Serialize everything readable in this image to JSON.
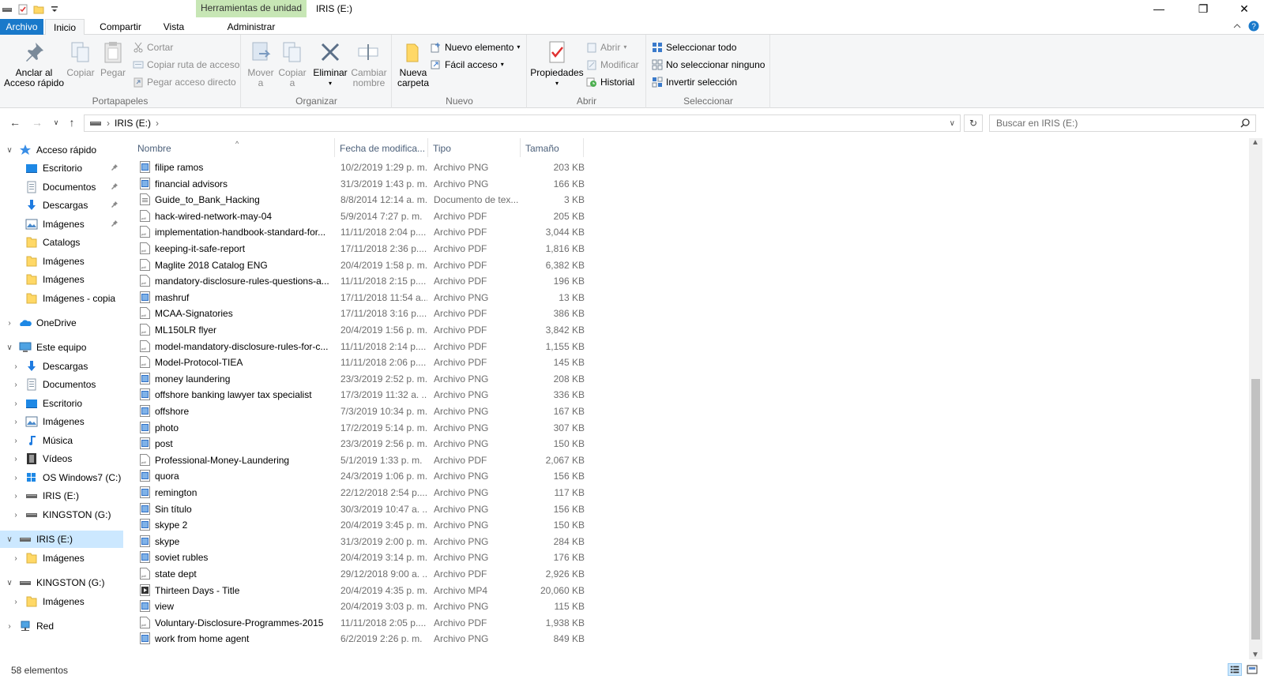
{
  "titlebar": {
    "context_tab": "Herramientas de unidad",
    "title": "IRIS (E:)",
    "minimize": "—",
    "restore": "❐",
    "close": "✕"
  },
  "tabs": {
    "archivo": "Archivo",
    "inicio": "Inicio",
    "compartir": "Compartir",
    "vista": "Vista",
    "administrar": "Administrar"
  },
  "ribbon": {
    "portapapeles": {
      "label": "Portapapeles",
      "pin": "Anclar al\nAcceso rápido",
      "pin_l1": "Anclar al",
      "pin_l2": "Acceso rápido",
      "copy": "Copiar",
      "paste": "Pegar",
      "cut": "Cortar",
      "copy_path": "Copiar ruta de acceso",
      "paste_shortcut": "Pegar acceso directo"
    },
    "organizar": {
      "label": "Organizar",
      "move_l1": "Mover",
      "move_l2": "a",
      "copy_l1": "Copiar",
      "copy_l2": "a",
      "delete": "Eliminar",
      "rename_l1": "Cambiar",
      "rename_l2": "nombre"
    },
    "nuevo": {
      "label": "Nuevo",
      "folder_l1": "Nueva",
      "folder_l2": "carpeta",
      "new_item": "Nuevo elemento",
      "easy_access": "Fácil acceso"
    },
    "abrir": {
      "label": "Abrir",
      "properties": "Propiedades",
      "open": "Abrir",
      "edit": "Modificar",
      "history": "Historial"
    },
    "seleccionar": {
      "label": "Seleccionar",
      "select_all": "Seleccionar todo",
      "select_none": "No seleccionar ninguno",
      "invert": "Invertir selección"
    }
  },
  "address": {
    "path": "IRIS (E:)",
    "search_placeholder": "Buscar en IRIS (E:)"
  },
  "navpane": [
    {
      "label": "Acceso rápido",
      "icon": "star-icon",
      "level": 0,
      "chev": "∨"
    },
    {
      "label": "Escritorio",
      "icon": "desktop-icon",
      "level": 1,
      "pinned": true
    },
    {
      "label": "Documentos",
      "icon": "documents-icon",
      "level": 1,
      "pinned": true
    },
    {
      "label": "Descargas",
      "icon": "downloads-icon",
      "level": 1,
      "pinned": true
    },
    {
      "label": "Imágenes",
      "icon": "pictures-icon",
      "level": 1,
      "pinned": true
    },
    {
      "label": "Catalogs",
      "icon": "folder-icon",
      "level": 1
    },
    {
      "label": "Imágenes",
      "icon": "folder-icon",
      "level": 1
    },
    {
      "label": "Imágenes",
      "icon": "folder-icon",
      "level": 1
    },
    {
      "label": "Imágenes - copia",
      "icon": "folder-icon",
      "level": 1
    },
    {
      "label": "OneDrive",
      "icon": "onedrive-icon",
      "level": 0,
      "chev": "›"
    },
    {
      "label": "Este equipo",
      "icon": "computer-icon",
      "level": 0,
      "chev": "∨"
    },
    {
      "label": "Descargas",
      "icon": "downloads-icon",
      "level": 1,
      "chev": "›"
    },
    {
      "label": "Documentos",
      "icon": "documents-icon",
      "level": 1,
      "chev": "›"
    },
    {
      "label": "Escritorio",
      "icon": "desktop-icon",
      "level": 1,
      "chev": "›"
    },
    {
      "label": "Imágenes",
      "icon": "pictures-icon",
      "level": 1,
      "chev": "›"
    },
    {
      "label": "Música",
      "icon": "music-icon",
      "level": 1,
      "chev": "›"
    },
    {
      "label": "Vídeos",
      "icon": "videos-icon",
      "level": 1,
      "chev": "›"
    },
    {
      "label": "OS Windows7 (C:)",
      "icon": "windows-drive-icon",
      "level": 1,
      "chev": "›"
    },
    {
      "label": "IRIS (E:)",
      "icon": "drive-icon",
      "level": 1,
      "chev": "›"
    },
    {
      "label": "KINGSTON (G:)",
      "icon": "drive-icon",
      "level": 1,
      "chev": "›"
    },
    {
      "label": "IRIS (E:)",
      "icon": "drive-icon",
      "level": 0,
      "chev": "∨",
      "selected": true
    },
    {
      "label": "Imágenes",
      "icon": "folder-icon",
      "level": 1,
      "chev": "›"
    },
    {
      "label": "KINGSTON (G:)",
      "icon": "drive-icon",
      "level": 0,
      "chev": "∨"
    },
    {
      "label": "Imágenes",
      "icon": "folder-icon",
      "level": 1,
      "chev": "›"
    },
    {
      "label": "Red",
      "icon": "network-icon",
      "level": 0,
      "chev": "›"
    }
  ],
  "columns": {
    "name": "Nombre",
    "date": "Fecha de modifica...",
    "type": "Tipo",
    "size": "Tamaño"
  },
  "files": [
    {
      "name": "filipe ramos",
      "date": "10/2/2019 1:29 p. m.",
      "type": "Archivo PNG",
      "size": "203 KB",
      "kind": "png"
    },
    {
      "name": "financial advisors",
      "date": "31/3/2019 1:43 p. m.",
      "type": "Archivo PNG",
      "size": "166 KB",
      "kind": "png"
    },
    {
      "name": "Guide_to_Bank_Hacking",
      "date": "8/8/2014 12:14 a. m.",
      "type": "Documento de tex...",
      "size": "3 KB",
      "kind": "txt"
    },
    {
      "name": "hack-wired-network-may-04",
      "date": "5/9/2014 7:27 p. m.",
      "type": "Archivo PDF",
      "size": "205 KB",
      "kind": "pdf"
    },
    {
      "name": "implementation-handbook-standard-for...",
      "date": "11/11/2018 2:04 p....",
      "type": "Archivo PDF",
      "size": "3,044 KB",
      "kind": "pdf"
    },
    {
      "name": "keeping-it-safe-report",
      "date": "17/11/2018 2:36 p....",
      "type": "Archivo PDF",
      "size": "1,816 KB",
      "kind": "pdf"
    },
    {
      "name": "Maglite 2018 Catalog ENG",
      "date": "20/4/2019 1:58 p. m.",
      "type": "Archivo PDF",
      "size": "6,382 KB",
      "kind": "pdf"
    },
    {
      "name": "mandatory-disclosure-rules-questions-a...",
      "date": "11/11/2018 2:15 p....",
      "type": "Archivo PDF",
      "size": "196 KB",
      "kind": "pdf"
    },
    {
      "name": "mashruf",
      "date": "17/11/2018 11:54 a...",
      "type": "Archivo PNG",
      "size": "13 KB",
      "kind": "png"
    },
    {
      "name": "MCAA-Signatories",
      "date": "17/11/2018 3:16 p....",
      "type": "Archivo PDF",
      "size": "386 KB",
      "kind": "pdf"
    },
    {
      "name": "ML150LR flyer",
      "date": "20/4/2019 1:56 p. m.",
      "type": "Archivo PDF",
      "size": "3,842 KB",
      "kind": "pdf"
    },
    {
      "name": "model-mandatory-disclosure-rules-for-c...",
      "date": "11/11/2018 2:14 p....",
      "type": "Archivo PDF",
      "size": "1,155 KB",
      "kind": "pdf"
    },
    {
      "name": "Model-Protocol-TIEA",
      "date": "11/11/2018 2:06 p....",
      "type": "Archivo PDF",
      "size": "145 KB",
      "kind": "pdf"
    },
    {
      "name": "money laundering",
      "date": "23/3/2019 2:52 p. m.",
      "type": "Archivo PNG",
      "size": "208 KB",
      "kind": "png"
    },
    {
      "name": "offshore banking lawyer tax specialist",
      "date": "17/3/2019 11:32 a. ...",
      "type": "Archivo PNG",
      "size": "336 KB",
      "kind": "png"
    },
    {
      "name": "offshore",
      "date": "7/3/2019 10:34 p. m.",
      "type": "Archivo PNG",
      "size": "167 KB",
      "kind": "png"
    },
    {
      "name": "photo",
      "date": "17/2/2019 5:14 p. m.",
      "type": "Archivo PNG",
      "size": "307 KB",
      "kind": "png"
    },
    {
      "name": "post",
      "date": "23/3/2019 2:56 p. m.",
      "type": "Archivo PNG",
      "size": "150 KB",
      "kind": "png"
    },
    {
      "name": "Professional-Money-Laundering",
      "date": "5/1/2019 1:33 p. m.",
      "type": "Archivo PDF",
      "size": "2,067 KB",
      "kind": "pdf"
    },
    {
      "name": "quora",
      "date": "24/3/2019 1:06 p. m.",
      "type": "Archivo PNG",
      "size": "156 KB",
      "kind": "png"
    },
    {
      "name": "remington",
      "date": "22/12/2018 2:54 p....",
      "type": "Archivo PNG",
      "size": "117 KB",
      "kind": "png"
    },
    {
      "name": "Sin título",
      "date": "30/3/2019 10:47 a. ...",
      "type": "Archivo PNG",
      "size": "156 KB",
      "kind": "png"
    },
    {
      "name": "skype 2",
      "date": "20/4/2019 3:45 p. m.",
      "type": "Archivo PNG",
      "size": "150 KB",
      "kind": "png"
    },
    {
      "name": "skype",
      "date": "31/3/2019 2:00 p. m.",
      "type": "Archivo PNG",
      "size": "284 KB",
      "kind": "png"
    },
    {
      "name": "soviet rubles",
      "date": "20/4/2019 3:14 p. m.",
      "type": "Archivo PNG",
      "size": "176 KB",
      "kind": "png"
    },
    {
      "name": "state dept",
      "date": "29/12/2018 9:00 a. ...",
      "type": "Archivo PDF",
      "size": "2,926 KB",
      "kind": "pdf"
    },
    {
      "name": "Thirteen Days - Title",
      "date": "20/4/2019 4:35 p. m.",
      "type": "Archivo MP4",
      "size": "20,060 KB",
      "kind": "mp4"
    },
    {
      "name": "view",
      "date": "20/4/2019 3:03 p. m.",
      "type": "Archivo PNG",
      "size": "115 KB",
      "kind": "png"
    },
    {
      "name": "Voluntary-Disclosure-Programmes-2015",
      "date": "11/11/2018 2:05 p....",
      "type": "Archivo PDF",
      "size": "1,938 KB",
      "kind": "pdf"
    },
    {
      "name": "work from home agent",
      "date": "6/2/2019 2:26 p. m.",
      "type": "Archivo PNG",
      "size": "849 KB",
      "kind": "png"
    }
  ],
  "status": {
    "count": "58 elementos"
  },
  "colors": {
    "accent": "#1979ca",
    "context_tab": "#c7e6b5",
    "selection": "#cce8ff",
    "folder": "#ffd866"
  }
}
